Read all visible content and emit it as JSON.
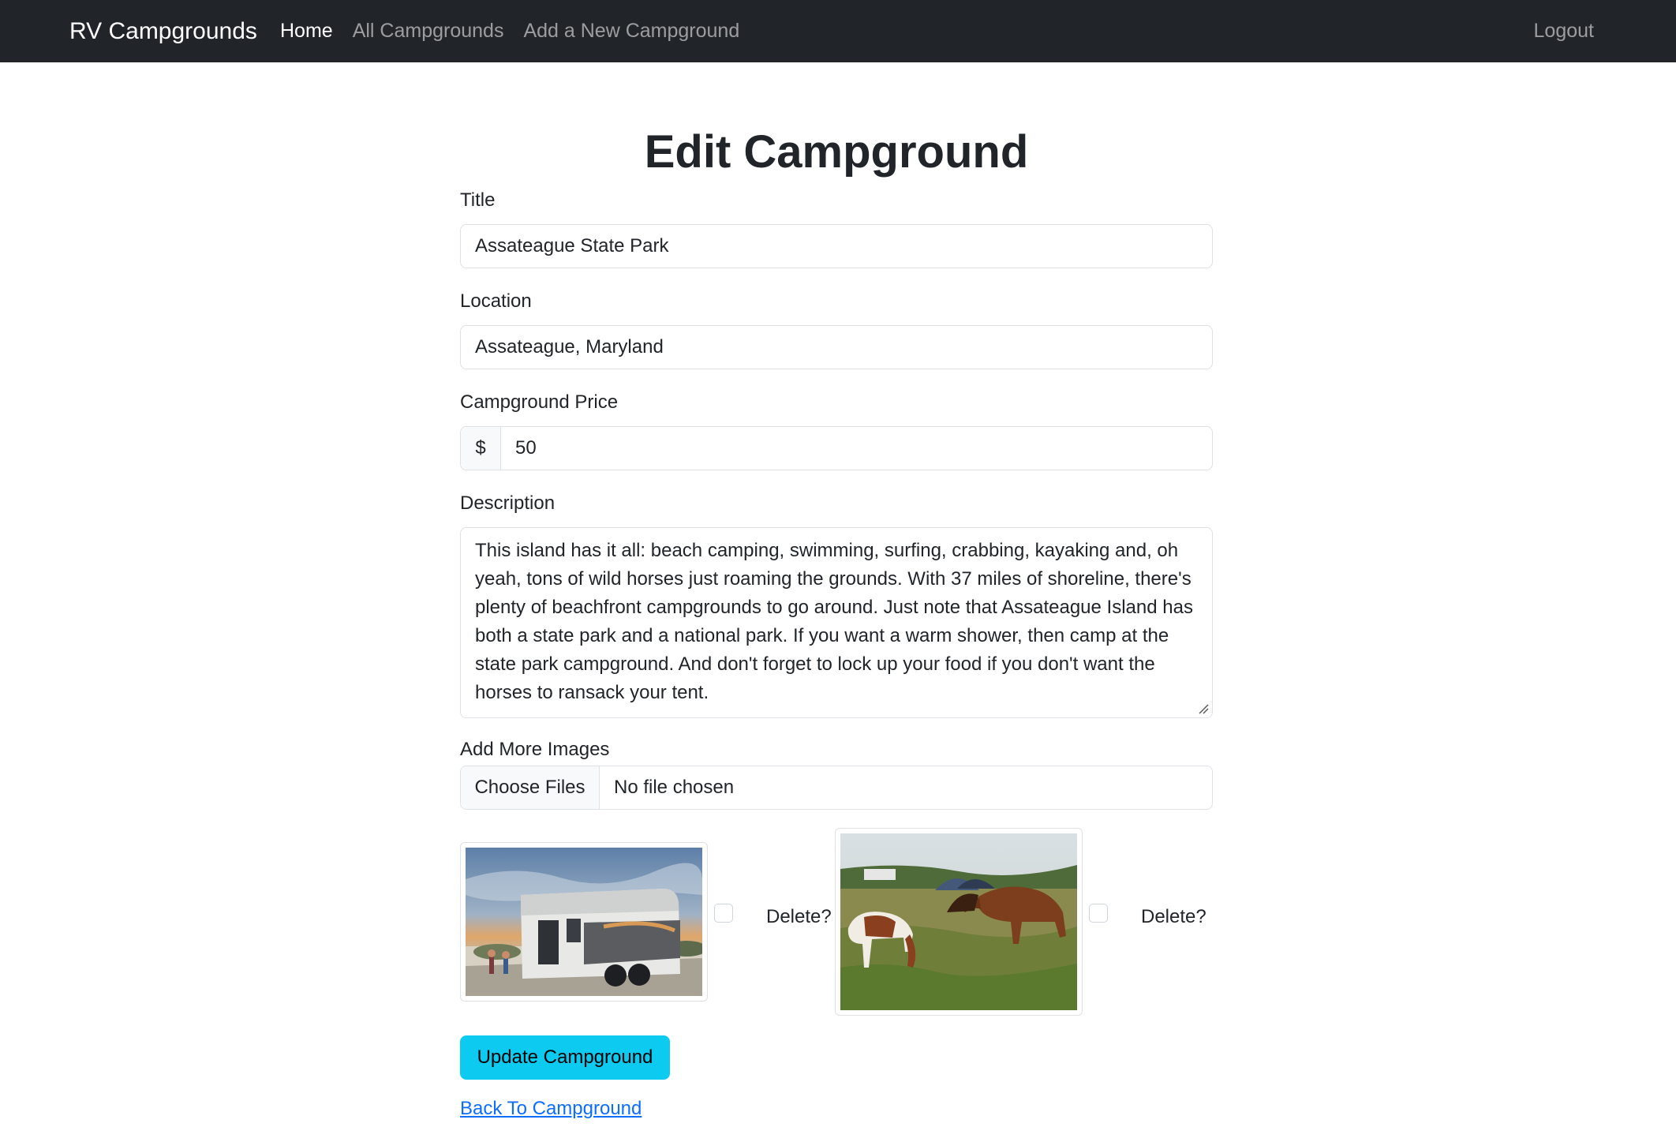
{
  "navbar": {
    "brand": "RV Campgrounds",
    "links": [
      {
        "label": "Home",
        "active": true
      },
      {
        "label": "All Campgrounds",
        "active": false
      },
      {
        "label": "Add a New Campground",
        "active": false
      }
    ],
    "logout": "Logout"
  },
  "form": {
    "heading": "Edit Campground",
    "title": {
      "label": "Title",
      "value": "Assateague State Park"
    },
    "location": {
      "label": "Location",
      "value": "Assateague, Maryland"
    },
    "price": {
      "label": "Campground Price",
      "prefix": "$",
      "value": "50"
    },
    "description": {
      "label": "Description",
      "value": "This island has it all: beach camping, swimming, surfing, crabbing, kayaking and, oh yeah, tons of wild horses just roaming the grounds. With 37 miles of shoreline, there's plenty of beachfront campgrounds to go around. Just note that Assateague Island has both a state park and a national park. If you want a warm shower, then camp at the state park campground. And don't forget to lock up your food if you don't want the horses to ransack your tent."
    },
    "images": {
      "label": "Add More Images",
      "button": "Choose Files",
      "status": "No file chosen"
    },
    "existing_images": [
      {
        "subject": "rv-trailer-at-beach-campsite",
        "delete_label": "Delete?",
        "checked": false
      },
      {
        "subject": "wild-horses-grazing-near-tents",
        "delete_label": "Delete?",
        "checked": false
      }
    ],
    "submit": "Update Campground",
    "back_link": "Back To Campground"
  },
  "colors": {
    "navbar_bg": "#212529",
    "button_info": "#0dcaf0",
    "link": "#0d6efd"
  }
}
